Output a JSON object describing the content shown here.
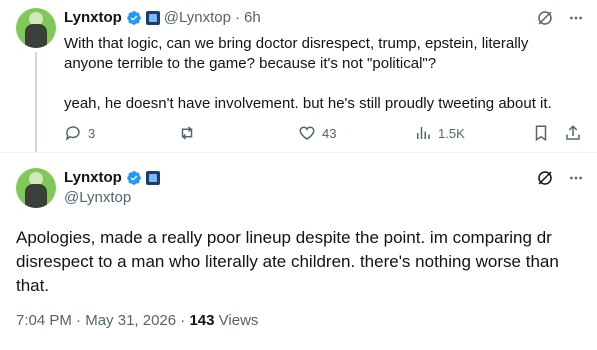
{
  "reply_tweet": {
    "author_name": "Lynxtop",
    "handle": "@Lynxtop",
    "separator": "·",
    "time_ago": "6h",
    "text_line1": "With that logic, can we bring doctor disrespect, trump, epstein, literally",
    "text_line2": "anyone terrible to the game? because it's not \"political\"?",
    "text_line3": "yeah, he doesn't have involvement. but he's still proudly tweeting about it.",
    "replies": "3",
    "likes": "43",
    "views": "1.5K"
  },
  "main_tweet": {
    "author_name": "Lynxtop",
    "handle": "@Lynxtop",
    "text_line1": "Apologies, made a really poor lineup despite the point. im comparing dr",
    "text_line2": "disrespect to a man who literally ate children. there's nothing worse than",
    "text_line3": "that.",
    "time": "7:04 PM",
    "separator": "·",
    "date": "May 31, 2026",
    "view_count": "143",
    "views_label": "Views"
  },
  "colors": {
    "verified": "#1d9bf0",
    "text_primary": "#0f1419",
    "text_secondary": "#536471",
    "avatar_bg": "#7fc85a"
  }
}
